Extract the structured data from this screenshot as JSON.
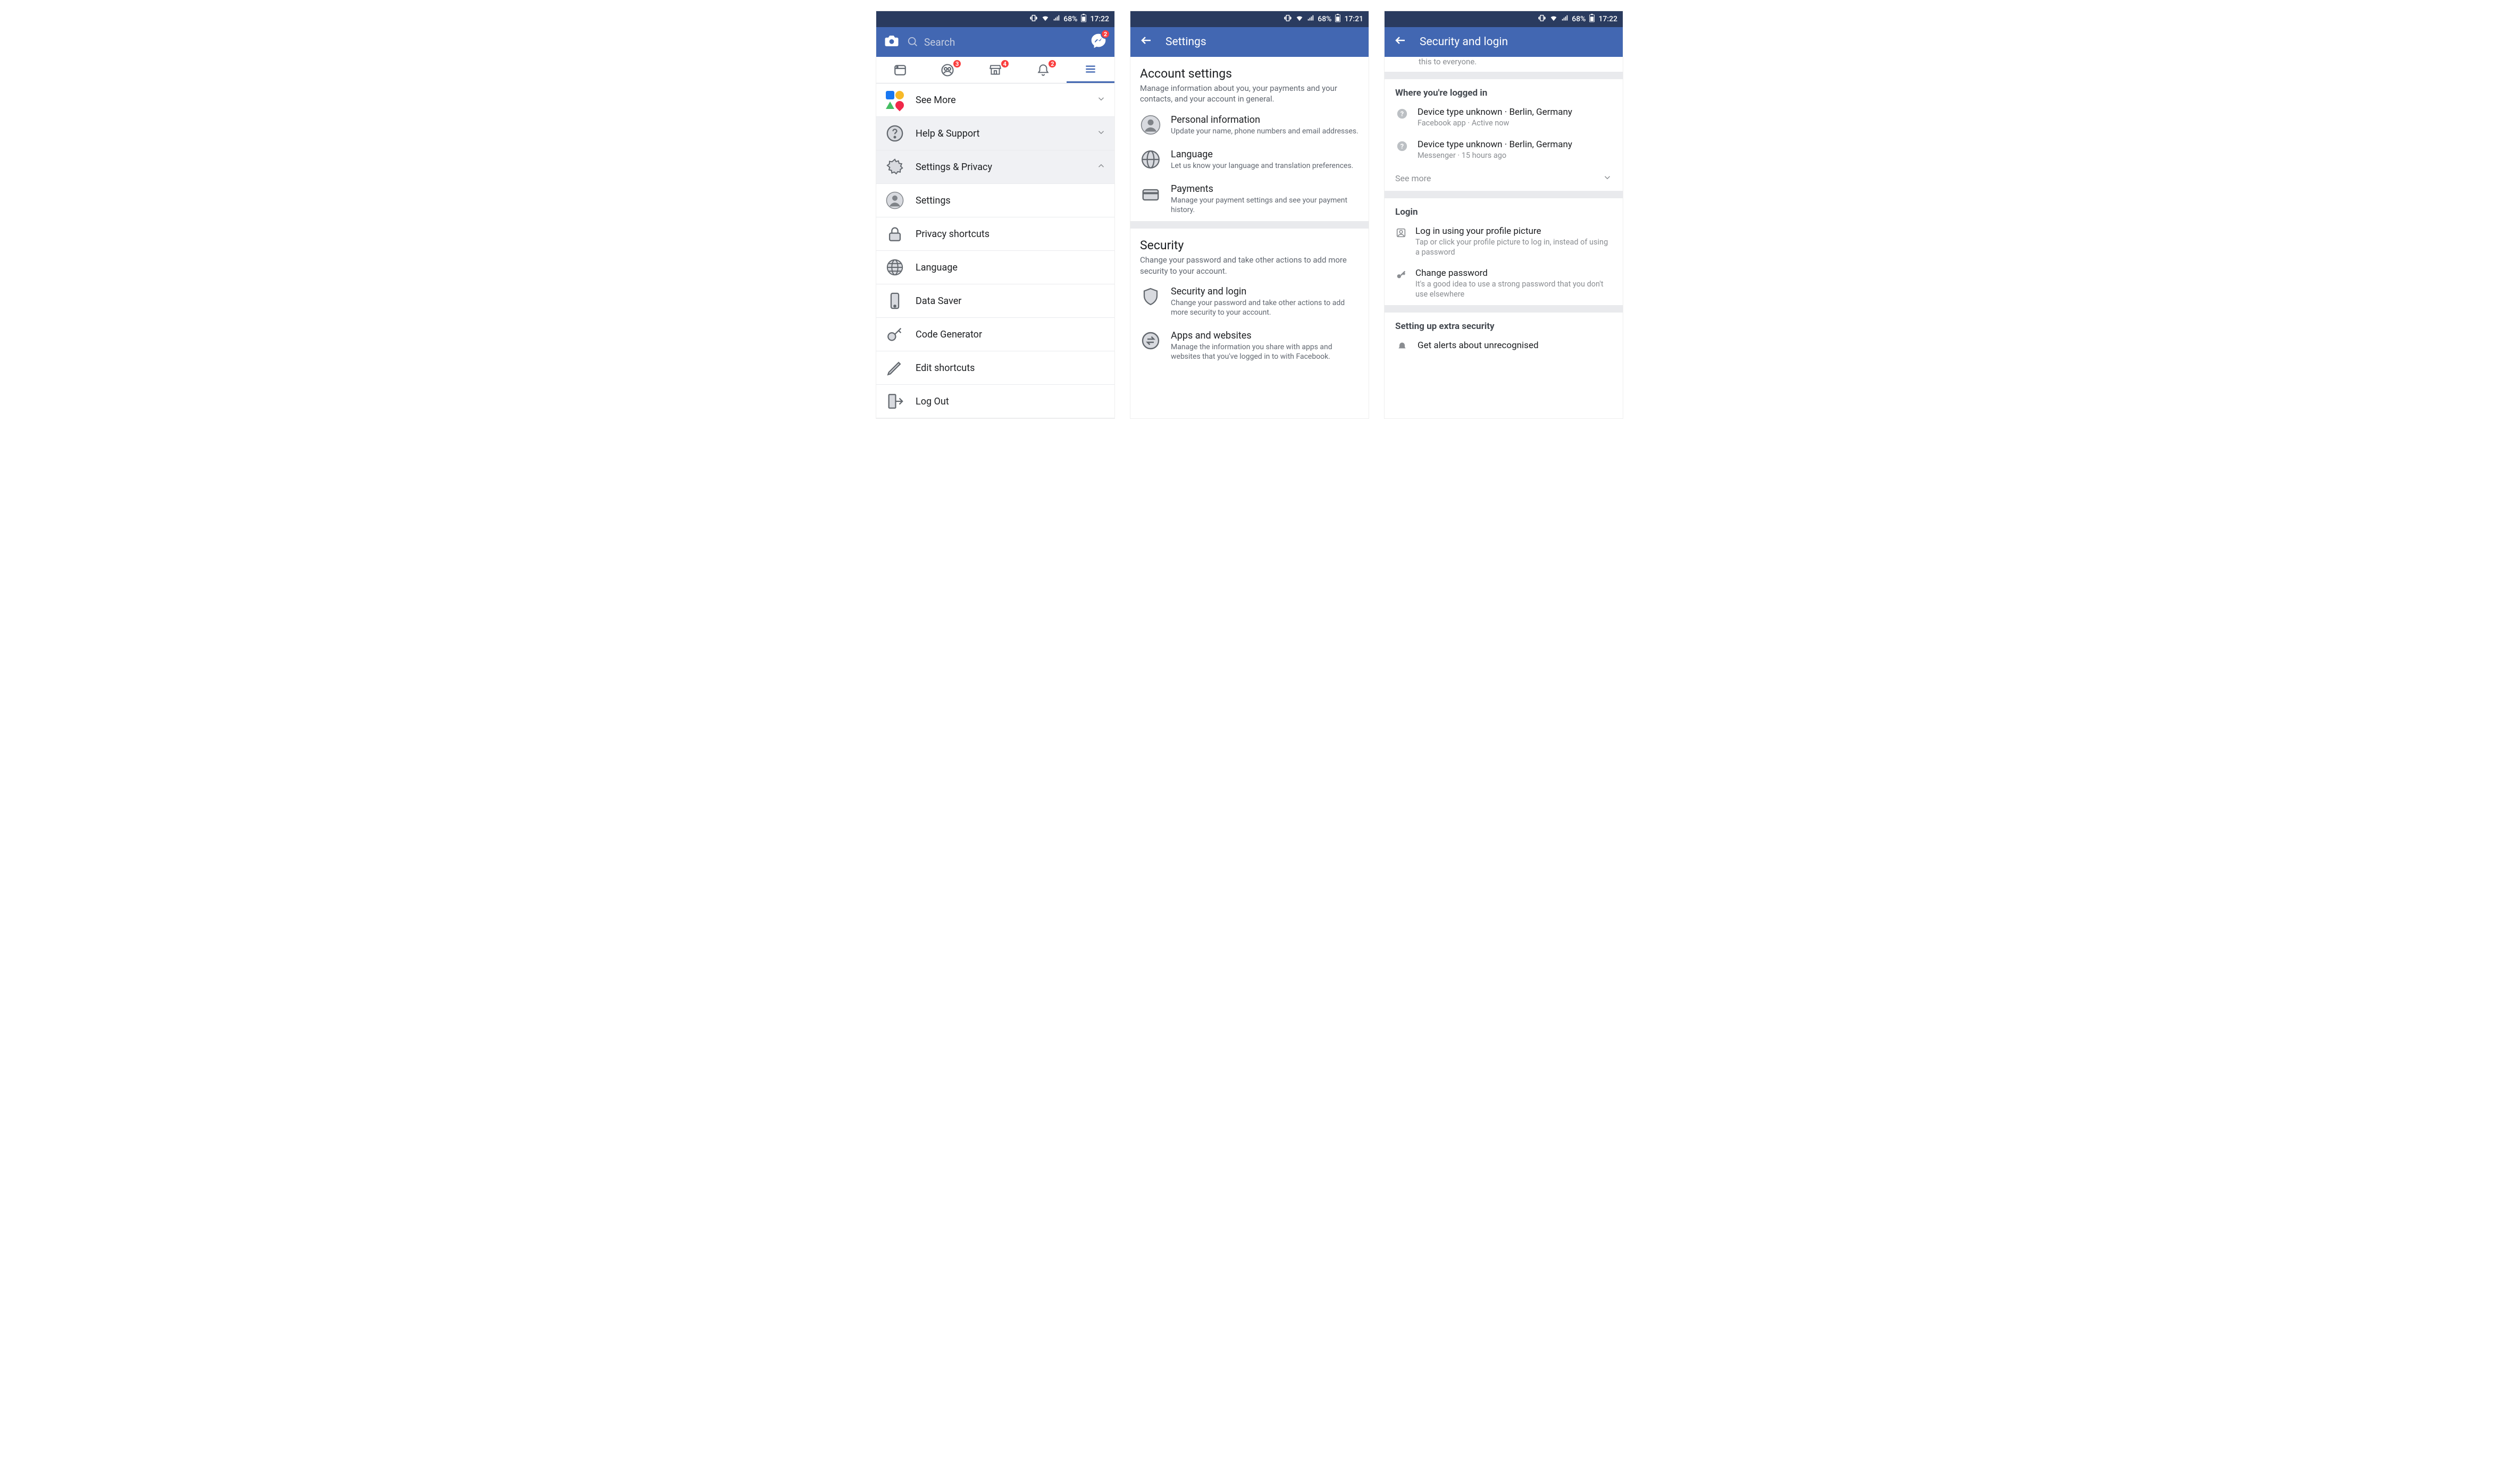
{
  "status": {
    "battery_pct": "68%",
    "time_a": "17:22",
    "time_b": "17:21",
    "time_c": "17:22"
  },
  "phone1": {
    "search_placeholder": "Search",
    "messenger_badge": "2",
    "tabs": {
      "friends_badge": "3",
      "market_badge": "4",
      "notif_badge": "2"
    },
    "menu": {
      "see_more": "See More",
      "help": "Help & Support",
      "settings_privacy": "Settings & Privacy",
      "settings": "Settings",
      "privacy_shortcuts": "Privacy shortcuts",
      "language": "Language",
      "data_saver": "Data Saver",
      "code_generator": "Code Generator",
      "edit_shortcuts": "Edit shortcuts",
      "log_out": "Log Out"
    }
  },
  "phone2": {
    "header": "Settings",
    "acct_title": "Account settings",
    "acct_desc": "Manage information about you, your payments and your contacts, and your account in general.",
    "personal_t": "Personal information",
    "personal_d": "Update your name, phone numbers and email addresses.",
    "language_t": "Language",
    "language_d": "Let us know your language and translation preferences.",
    "payments_t": "Payments",
    "payments_d": "Manage your payment settings and see your payment history.",
    "sec_title": "Security",
    "sec_desc": "Change your password and take other actions to add more security to your account.",
    "seclogin_t": "Security and login",
    "seclogin_d": "Change your password and take other actions to add more security to your account.",
    "apps_t": "Apps and websites",
    "apps_d": "Manage the information you share with apps and websites that you've logged in to with Facebook."
  },
  "phone3": {
    "header": "Security and login",
    "truncated": "this to everyone.",
    "where_title": "Where you're logged in",
    "sess1_t": "Device type unknown · Berlin, Germany",
    "sess1_d": "Facebook app · Active now",
    "sess2_t": "Device type unknown · Berlin, Germany",
    "sess2_d": "Messenger · 15 hours ago",
    "see_more": "See more",
    "login_title": "Login",
    "pic_t": "Log in using your profile picture",
    "pic_d": "Tap or click your profile picture to log in, instead of using a password",
    "pw_t": "Change password",
    "pw_d": "It's a good idea to use a strong password that you don't use elsewhere",
    "extra_title": "Setting up extra security",
    "alerts_t": "Get alerts about unrecognised"
  }
}
